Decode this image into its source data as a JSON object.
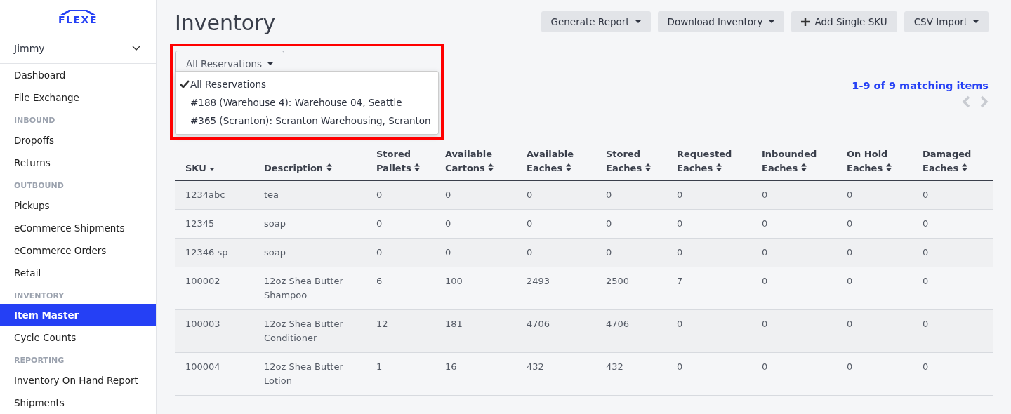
{
  "sidebar": {
    "logo": "FLEXE",
    "account": {
      "name": "Jimmy",
      "expanded": false
    },
    "sections": [
      {
        "items": [
          {
            "label": "Dashboard",
            "selected": false
          },
          {
            "label": "File Exchange",
            "selected": false
          }
        ]
      },
      {
        "heading": "INBOUND",
        "items": [
          {
            "label": "Dropoffs",
            "selected": false
          },
          {
            "label": "Returns",
            "selected": false
          }
        ]
      },
      {
        "heading": "OUTBOUND",
        "items": [
          {
            "label": "Pickups",
            "selected": false
          },
          {
            "label": "eCommerce Shipments",
            "selected": false
          },
          {
            "label": "eCommerce Orders",
            "selected": false
          },
          {
            "label": "Retail",
            "selected": false
          }
        ]
      },
      {
        "heading": "INVENTORY",
        "items": [
          {
            "label": "Item Master",
            "selected": true
          },
          {
            "label": "Cycle Counts",
            "selected": false
          }
        ]
      },
      {
        "heading": "REPORTING",
        "items": [
          {
            "label": "Inventory On Hand Report",
            "selected": false
          },
          {
            "label": "Shipments",
            "selected": false
          }
        ]
      }
    ]
  },
  "title": "Inventory",
  "actions": [
    {
      "label": "Generate Report",
      "kind": "dropdown"
    },
    {
      "label": "Download Inventory",
      "kind": "dropdown"
    },
    {
      "label": "Add Single SKU",
      "kind": "add"
    },
    {
      "label": "CSV Import",
      "kind": "dropdown"
    }
  ],
  "reservation_filter": {
    "label": "All Reservations",
    "expanded": true,
    "options": [
      {
        "label": "All Reservations",
        "selected": true
      },
      {
        "label": "#188 (Warehouse 4): Warehouse 04, Seattle",
        "selected": false
      },
      {
        "label": "#365 (Scranton): Scranton Warehousing, Scranton",
        "selected": false
      }
    ]
  },
  "pagination": {
    "summary": "1-9 of 9 matching items"
  },
  "table": {
    "columns": [
      {
        "label": "SKU",
        "sorted": true
      },
      {
        "label": "Description",
        "sorted": false
      },
      {
        "label": "Stored Pallets",
        "sorted": false
      },
      {
        "label": "Available Cartons",
        "sorted": false
      },
      {
        "label": "Available Eaches",
        "sorted": false
      },
      {
        "label": "Stored Eaches",
        "sorted": false
      },
      {
        "label": "Requested Eaches",
        "sorted": false
      },
      {
        "label": "Inbounded Eaches",
        "sorted": false
      },
      {
        "label": "On Hold Eaches",
        "sorted": false
      },
      {
        "label": "Damaged Eaches",
        "sorted": false
      }
    ],
    "rows": [
      [
        "1234abc",
        "tea",
        "0",
        "0",
        "0",
        "0",
        "0",
        "0",
        "0",
        "0"
      ],
      [
        "12345",
        "soap",
        "0",
        "0",
        "0",
        "0",
        "0",
        "0",
        "0",
        "0"
      ],
      [
        "12346 sp",
        "soap",
        "0",
        "0",
        "0",
        "0",
        "0",
        "0",
        "0",
        "0"
      ],
      [
        "100002",
        "12oz Shea Butter Shampoo",
        "6",
        "100",
        "2493",
        "2500",
        "7",
        "0",
        "0",
        "0"
      ],
      [
        "100003",
        "12oz Shea Butter Conditioner",
        "12",
        "181",
        "4706",
        "4706",
        "0",
        "0",
        "0",
        "0"
      ],
      [
        "100004",
        "12oz Shea Butter Lotion",
        "1",
        "16",
        "432",
        "432",
        "0",
        "0",
        "0",
        "0"
      ]
    ]
  }
}
